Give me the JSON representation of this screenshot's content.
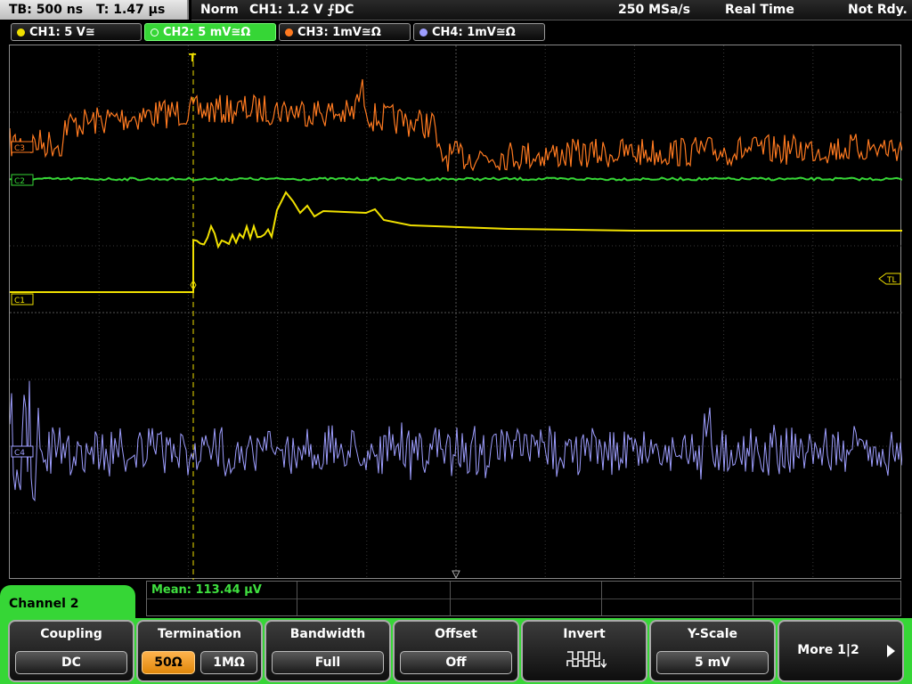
{
  "header": {
    "timebase": "TB: 500 ns",
    "trigger_time": "T: 1.47 µs",
    "mode": "Norm",
    "trigger_setting": "CH1: 1.2 V ⨍DC",
    "sample_rate": "250 MSa/s",
    "acq_mode": "Real Time",
    "state": "Not Rdy."
  },
  "channels": [
    {
      "label": "CH1: 5 V≅",
      "color": "#f0e000",
      "active": false
    },
    {
      "label": "CH2: 5 mV≅Ω",
      "color": "#36d636",
      "active": true
    },
    {
      "label": "CH3: 1mV≅Ω",
      "color": "#ff7a20",
      "active": false
    },
    {
      "label": "CH4: 1mV≅Ω",
      "color": "#9e9eff",
      "active": false
    }
  ],
  "markers": {
    "trigger_marker": "T",
    "trigger_level": "TL",
    "ch1_ref": "C1",
    "ch2_ref": "C2",
    "ch3_ref": "C3",
    "ch4_ref": "C4"
  },
  "channel_panel": {
    "title": "Channel 2"
  },
  "measurement": {
    "text": "Mean: 113.44 µV"
  },
  "softkeys": {
    "coupling": {
      "title": "Coupling",
      "value": "DC"
    },
    "termination": {
      "title": "Termination",
      "opt1": "50Ω",
      "opt2": "1MΩ",
      "selected": "50Ω"
    },
    "bandwidth": {
      "title": "Bandwidth",
      "value": "Full"
    },
    "offset": {
      "title": "Offset",
      "value": "Off"
    },
    "invert": {
      "title": "Invert",
      "icon": "inverted-square-wave-icon"
    },
    "yscale": {
      "title": "Y-Scale",
      "value": "5 mV"
    },
    "more": {
      "label": "More 1|2"
    }
  },
  "colors": {
    "ch1": "#f0e000",
    "ch2": "#36d636",
    "ch3": "#ff7a20",
    "ch4": "#9e9eff",
    "softkey_bar": "#36d636",
    "selected_option": "#f5a020"
  }
}
